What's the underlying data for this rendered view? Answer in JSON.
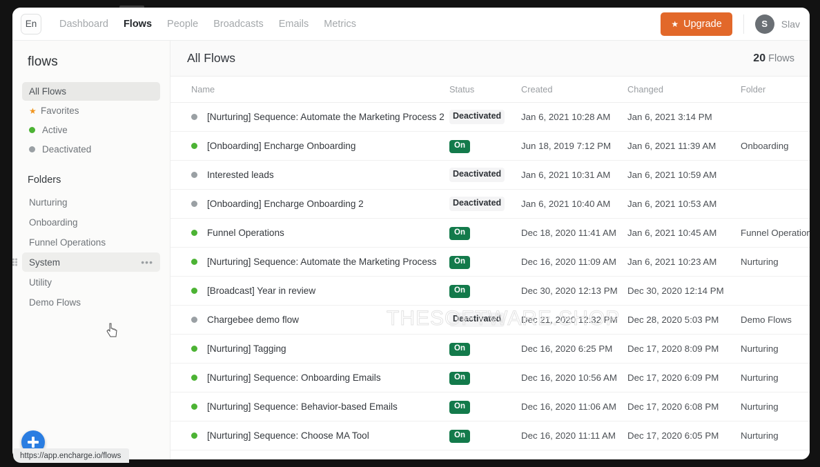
{
  "browser": {
    "status_url": "https://app.encharge.io/flows"
  },
  "topnav": {
    "lang_badge": "En",
    "links": [
      {
        "label": "Dashboard",
        "active": false
      },
      {
        "label": "Flows",
        "active": true
      },
      {
        "label": "People",
        "active": false
      },
      {
        "label": "Broadcasts",
        "active": false
      },
      {
        "label": "Emails",
        "active": false
      },
      {
        "label": "Metrics",
        "active": false
      }
    ],
    "upgrade_label": "Upgrade",
    "upgrade_color": "#e2682a",
    "avatar_initial": "S",
    "user_name": "Slav"
  },
  "sidebar": {
    "title": "flows",
    "items": [
      {
        "label": "All Flows",
        "icon": "none",
        "selected": true
      },
      {
        "label": "Favorites",
        "icon": "star",
        "color": "#f0951f",
        "selected": false
      },
      {
        "label": "Active",
        "icon": "dot",
        "color": "#4cb334",
        "selected": false
      },
      {
        "label": "Deactivated",
        "icon": "dot",
        "color": "#9aa0a4",
        "selected": false
      }
    ],
    "folders_title": "Folders",
    "folders": [
      {
        "label": "Nurturing",
        "hovered": false
      },
      {
        "label": "Onboarding",
        "hovered": false
      },
      {
        "label": "Funnel Operations",
        "hovered": false
      },
      {
        "label": "System",
        "hovered": true,
        "more": "•••"
      },
      {
        "label": "Utility",
        "hovered": false
      },
      {
        "label": "Demo Flows",
        "hovered": false
      }
    ],
    "add_button_label": "+"
  },
  "main": {
    "title": "All Flows",
    "count_number": "20",
    "count_label": "Flows",
    "columns": [
      "Name",
      "Status",
      "Created",
      "Changed",
      "Folder"
    ],
    "rows": [
      {
        "dot": "#9aa0a4",
        "name": "[Nurturing] Sequence: Automate the Marketing Process 2",
        "status": "Deactivated",
        "status_on": false,
        "created": "Jan 6, 2021 10:28 AM",
        "changed": "Jan 6, 2021 3:14 PM",
        "folder": ""
      },
      {
        "dot": "#4cb334",
        "name": "[Onboarding] Encharge Onboarding",
        "status": "On",
        "status_on": true,
        "created": "Jun 18, 2019 7:12 PM",
        "changed": "Jan 6, 2021 11:39 AM",
        "folder": "Onboarding"
      },
      {
        "dot": "#9aa0a4",
        "name": "Interested leads",
        "status": "Deactivated",
        "status_on": false,
        "created": "Jan 6, 2021 10:31 AM",
        "changed": "Jan 6, 2021 10:59 AM",
        "folder": ""
      },
      {
        "dot": "#9aa0a4",
        "name": "[Onboarding] Encharge Onboarding 2",
        "status": "Deactivated",
        "status_on": false,
        "created": "Jan 6, 2021 10:40 AM",
        "changed": "Jan 6, 2021 10:53 AM",
        "folder": ""
      },
      {
        "dot": "#4cb334",
        "name": "Funnel Operations",
        "status": "On",
        "status_on": true,
        "created": "Dec 18, 2020 11:41 AM",
        "changed": "Jan 6, 2021 10:45 AM",
        "folder": "Funnel Operations"
      },
      {
        "dot": "#4cb334",
        "name": "[Nurturing] Sequence: Automate the Marketing Process",
        "status": "On",
        "status_on": true,
        "created": "Dec 16, 2020 11:09 AM",
        "changed": "Jan 6, 2021 10:23 AM",
        "folder": "Nurturing"
      },
      {
        "dot": "#4cb334",
        "name": "[Broadcast] Year in review",
        "status": "On",
        "status_on": true,
        "created": "Dec 30, 2020 12:13 PM",
        "changed": "Dec 30, 2020 12:14 PM",
        "folder": ""
      },
      {
        "dot": "#9aa0a4",
        "name": "Chargebee demo flow",
        "status": "Deactivated",
        "status_on": false,
        "created": "Dec 21, 2020 12:32 PM",
        "changed": "Dec 28, 2020 5:03 PM",
        "folder": "Demo Flows"
      },
      {
        "dot": "#4cb334",
        "name": "[Nurturing] Tagging",
        "status": "On",
        "status_on": true,
        "created": "Dec 16, 2020 6:25 PM",
        "changed": "Dec 17, 2020 8:09 PM",
        "folder": "Nurturing"
      },
      {
        "dot": "#4cb334",
        "name": "[Nurturing] Sequence: Onboarding Emails",
        "status": "On",
        "status_on": true,
        "created": "Dec 16, 2020 10:56 AM",
        "changed": "Dec 17, 2020 6:09 PM",
        "folder": "Nurturing"
      },
      {
        "dot": "#4cb334",
        "name": "[Nurturing] Sequence: Behavior-based Emails",
        "status": "On",
        "status_on": true,
        "created": "Dec 16, 2020 11:06 AM",
        "changed": "Dec 17, 2020 6:08 PM",
        "folder": "Nurturing"
      },
      {
        "dot": "#4cb334",
        "name": "[Nurturing] Sequence: Choose MA Tool",
        "status": "On",
        "status_on": true,
        "created": "Dec 16, 2020 11:11 AM",
        "changed": "Dec 17, 2020 6:05 PM",
        "folder": "Nurturing"
      }
    ]
  },
  "watermark": {
    "text": "THESOFTWARE.SHOP"
  }
}
